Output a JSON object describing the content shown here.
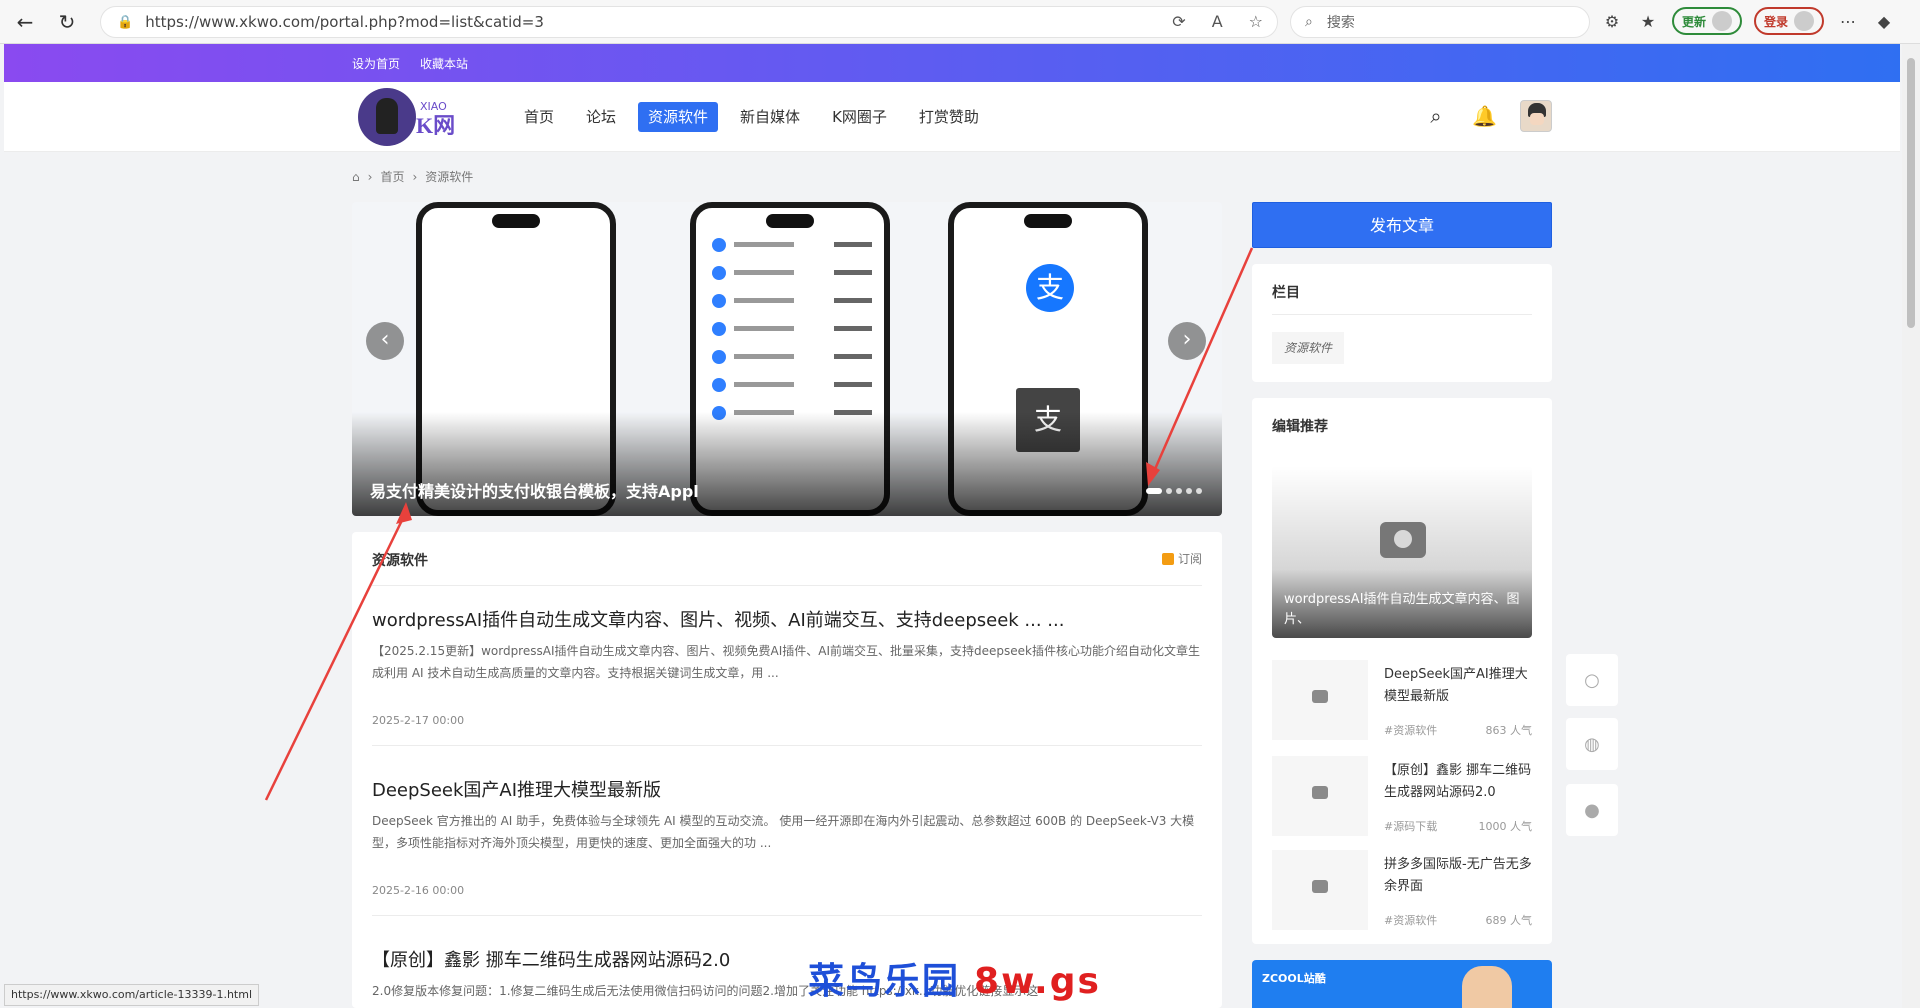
{
  "browser": {
    "url": "https://www.xkwo.com/portal.php?mod=list&catid=3",
    "search_placeholder": "搜索",
    "update_label": "更新",
    "login_label": "登录"
  },
  "topstrip": {
    "links": [
      "设为首页",
      "收藏本站"
    ]
  },
  "header": {
    "logo_small": "XIAO",
    "logo_text": "K网",
    "menu": [
      "首页",
      "论坛",
      "资源软件",
      "新自媒体",
      "K网圈子",
      "打赏赞助"
    ],
    "active_index": 2
  },
  "breadcrumb": {
    "home": "首页",
    "current": "资源软件"
  },
  "carousel": {
    "title": "易支付精美设计的支付收银台模板，支持Appl",
    "slides": 5,
    "active": 0
  },
  "list": {
    "title": "资源软件",
    "subscribe": "订阅",
    "articles": [
      {
        "title": "wordpressAI插件自动生成文章内容、图片、视频、AI前端交互、支持deepseek ... ...",
        "desc": "【2025.2.15更新】wordpressAI插件自动生成文章内容、图片、视频免费AI插件、AI前端交互、批量采集，支持deepseek插件核心功能介绍自动化文章生成利用 AI 技术自动生成高质量的文章内容。支持根据关键词生成文章，用 ...",
        "date": "2025-2-17 00:00"
      },
      {
        "title": "DeepSeek国产AI推理大模型最新版",
        "desc": "DeepSeek 官方推出的 AI 助手，免费体验与全球领先 AI 模型的互动交流。 使用一经开源即在海内外引起震动、总参数超过 600B 的 DeepSeek-V3 大模型，多项性能指标对齐海外顶尖模型，用更快的速度、更加全面强大的功 ...",
        "date": "2025-2-16 00:00"
      },
      {
        "title": "【原创】鑫影 挪车二维码生成器网站源码2.0",
        "desc": "2.0修复版本修复问题：1.修复二维码生成后无法使用微信扫码访问的问题2.增加了关注功能 https://xk.. 功能优化链接显示这",
        "date": ""
      }
    ]
  },
  "sidebar": {
    "publish": "发布文章",
    "category_title": "栏目",
    "category_tag": "资源软件",
    "recommend_title": "编辑推荐",
    "featured": "wordpressAI插件自动生成文章内容、图片、",
    "items": [
      {
        "title": "DeepSeek国产AI推理大模型最新版",
        "tag": "#资源软件",
        "hot": "863 人气"
      },
      {
        "title": "【原创】鑫影 挪车二维码生成器网站源码2.0",
        "tag": "#源码下载",
        "hot": "1000 人气"
      },
      {
        "title": "拼多多国际版-无广告无多余界面",
        "tag": "#资源软件",
        "hot": "689 人气"
      }
    ],
    "ad_text": "ZCOOL站酷"
  },
  "statusbar": "https://www.xkwo.com/article-13339-1.html",
  "watermark": {
    "blue": "菜鸟乐园",
    "red": "8w.gs"
  },
  "colors": {
    "accent": "#2f6ff2",
    "strip_start": "#8a4af0",
    "strip_end": "#2f6ff2",
    "arrow": "#e8413c"
  }
}
